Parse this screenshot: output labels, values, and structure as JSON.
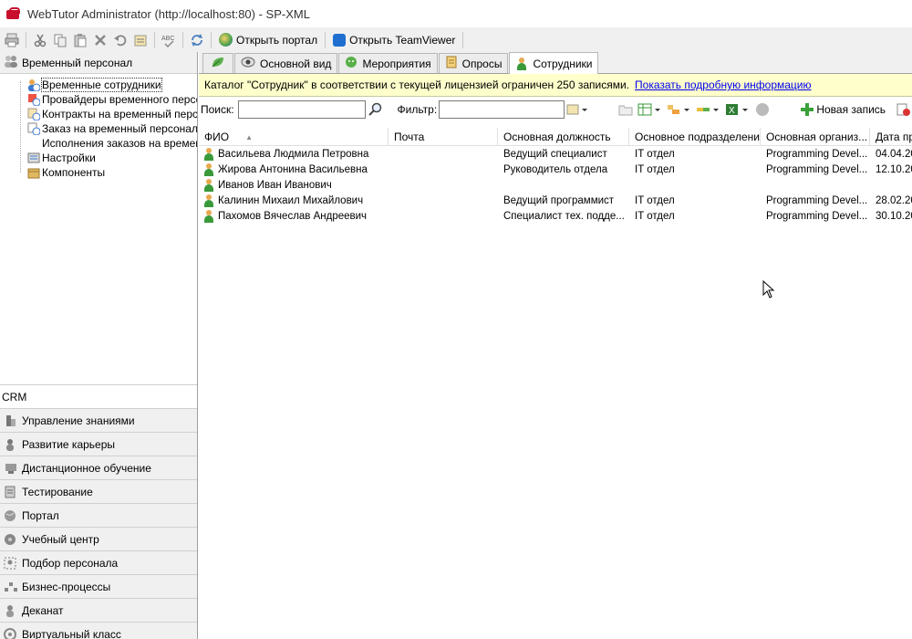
{
  "window": {
    "title": "WebTutor Administrator (http://localhost:80) - SP-XML"
  },
  "toolbar": {
    "open_portal": "Открыть портал",
    "open_teamviewer": "Открыть TeamViewer"
  },
  "left": {
    "header": "Временный персонал",
    "tree": [
      {
        "label": "Временные сотрудники",
        "icon": "people-clock-icon"
      },
      {
        "label": "Провайдеры временного персона",
        "icon": "provider-icon"
      },
      {
        "label": "Контракты на временный персон",
        "icon": "contract-icon"
      },
      {
        "label": "Заказ на временный персонал",
        "icon": "order-icon"
      },
      {
        "label": "Исполнения заказов на временны",
        "icon": "none"
      },
      {
        "label": "Настройки",
        "icon": "settings-icon"
      },
      {
        "label": "Компоненты",
        "icon": "box-icon"
      }
    ],
    "sections": [
      {
        "label": "CRM"
      },
      {
        "label": "Управление знаниями",
        "icon": "knowledge-icon"
      },
      {
        "label": "Развитие карьеры",
        "icon": "career-icon"
      },
      {
        "label": "Дистанционное обучение",
        "icon": "elearning-icon"
      },
      {
        "label": "Тестирование",
        "icon": "testing-icon"
      },
      {
        "label": "Портал",
        "icon": "globe-icon"
      },
      {
        "label": "Учебный центр",
        "icon": "training-center-icon"
      },
      {
        "label": "Подбор персонала",
        "icon": "recruiting-icon"
      },
      {
        "label": "Бизнес-процессы",
        "icon": "process-icon"
      },
      {
        "label": "Деканат",
        "icon": "dean-icon"
      },
      {
        "label": "Виртуальный класс",
        "icon": "virtual-class-icon"
      }
    ]
  },
  "tabs": [
    {
      "label": "",
      "icon": "leaf-icon"
    },
    {
      "label": "Основной вид",
      "icon": "eye-icon"
    },
    {
      "label": "Мероприятия",
      "icon": "events-icon"
    },
    {
      "label": "Опросы",
      "icon": "survey-icon"
    },
    {
      "label": "Сотрудники",
      "icon": "person-icon",
      "active": true
    }
  ],
  "license": {
    "text": "Каталог \"Сотрудник\" в соответствии с текущей лицензией ограничен 250 записями.",
    "link": "Показать подробную информацию"
  },
  "search": {
    "search_label": "Поиск:",
    "search_value": "",
    "filter_label": "Фильтр:",
    "filter_value": "",
    "new_record": "Новая запись"
  },
  "table": {
    "columns": [
      "ФИО",
      "Почта",
      "Основная должность",
      "Основное подразделение",
      "Основная организ...",
      "Дата пр"
    ],
    "rows": [
      [
        "Васильева Людмила Петровна",
        "",
        "Ведущий специалист",
        "IT отдел",
        "Programming Devel...",
        "04.04.20"
      ],
      [
        "Жирова Антонина Васильевна",
        "",
        "Руководитель отдела",
        "IT отдел",
        "Programming Devel...",
        "12.10.20"
      ],
      [
        "Иванов Иван Иванович",
        "",
        "",
        "",
        "",
        ""
      ],
      [
        "Калинин Михаил Михайлович",
        "",
        "Ведущий программист",
        "IT отдел",
        "Programming Devel...",
        "28.02.20"
      ],
      [
        "Пахомов Вячеслав Андреевич",
        "",
        "Специалист тех. подде...",
        "IT отдел",
        "Programming Devel...",
        "30.10.20"
      ]
    ]
  }
}
